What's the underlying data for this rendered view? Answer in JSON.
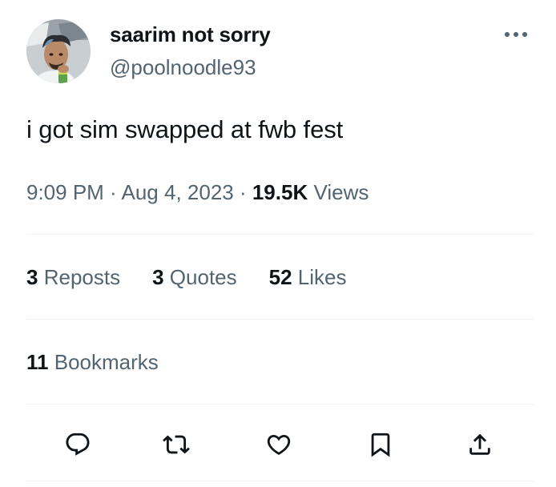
{
  "author": {
    "display_name": "saarim not sorry",
    "handle": "@poolnoodle93"
  },
  "tweet": {
    "text": "i got sim swapped at fwb fest",
    "time": "9:09 PM",
    "date": "Aug 4, 2023",
    "views_count": "19.5K",
    "views_label": "Views",
    "separator": " · "
  },
  "stats": {
    "reposts_count": "3",
    "reposts_label": "Reposts",
    "quotes_count": "3",
    "quotes_label": "Quotes",
    "likes_count": "52",
    "likes_label": "Likes",
    "bookmarks_count": "11",
    "bookmarks_label": "Bookmarks"
  },
  "actions": {
    "icons": [
      "reply-icon",
      "repost-icon",
      "like-icon",
      "bookmark-icon",
      "share-icon"
    ]
  },
  "colors": {
    "text_primary": "#0f1419",
    "text_secondary": "#536471",
    "divider": "#eff3f4"
  }
}
